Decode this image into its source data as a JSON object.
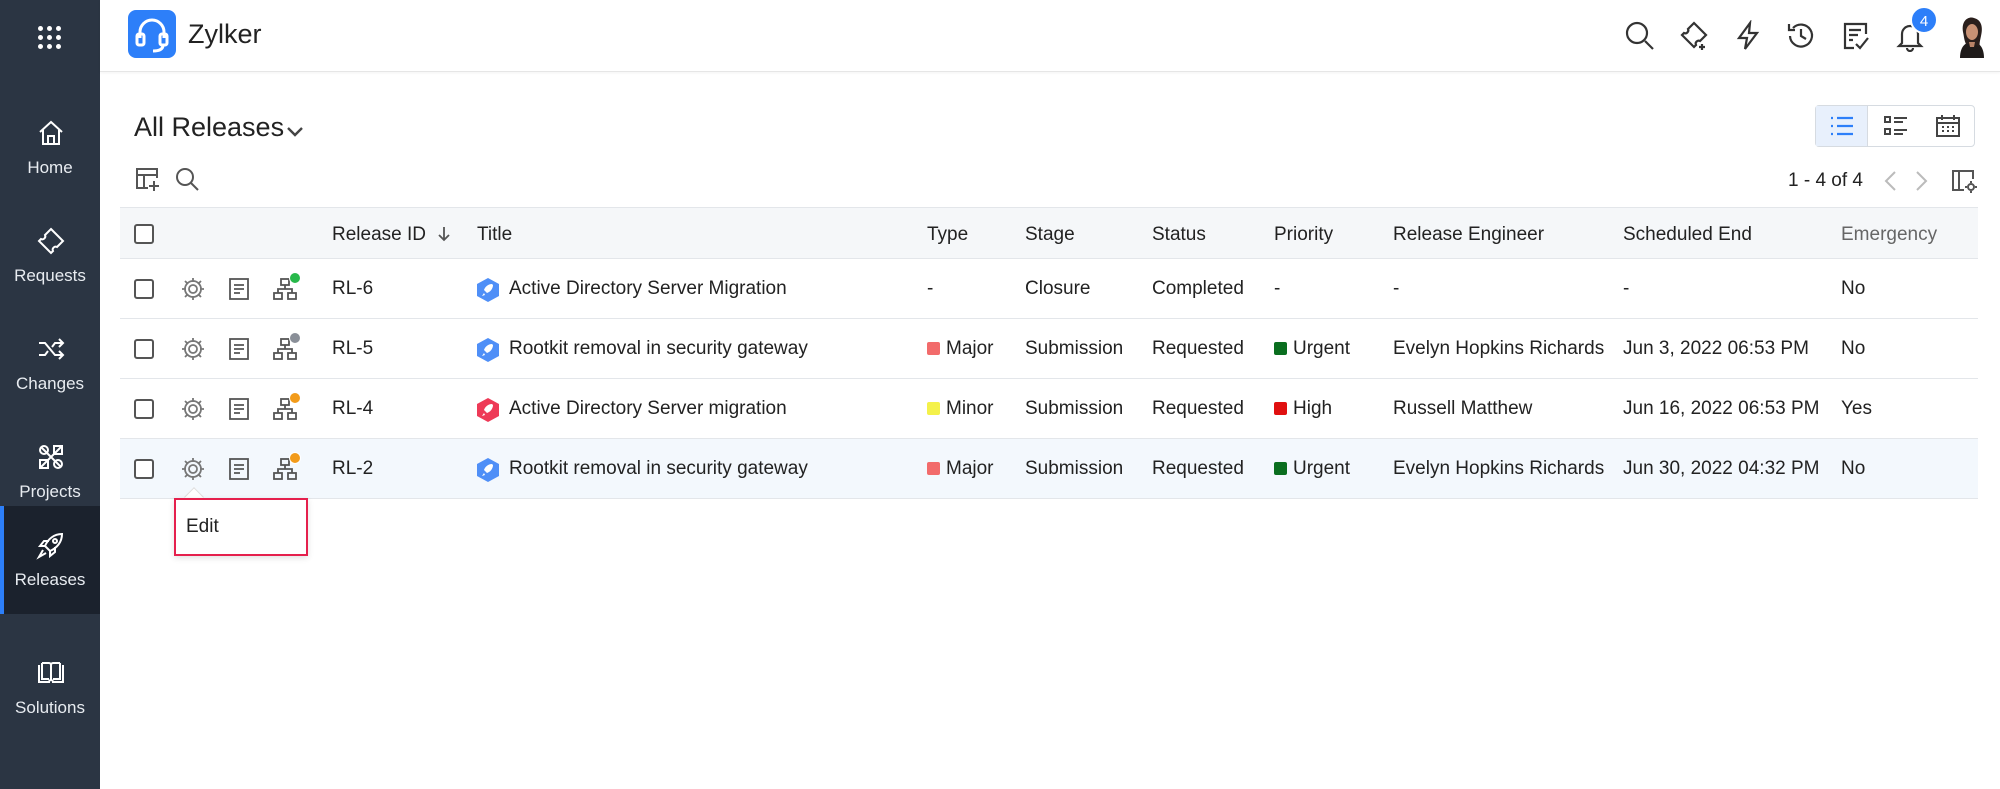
{
  "sidebar": {
    "items": [
      {
        "label": "Home",
        "icon": "home-icon"
      },
      {
        "label": "Requests",
        "icon": "ticket-icon"
      },
      {
        "label": "Changes",
        "icon": "shuffle-icon"
      },
      {
        "label": "Projects",
        "icon": "projects-icon"
      },
      {
        "label": "Releases",
        "icon": "rocket-icon",
        "active": true
      },
      {
        "label": "Solutions",
        "icon": "book-icon"
      }
    ]
  },
  "header": {
    "brand": "Zylker",
    "notification_count": "4",
    "icons": [
      "search-icon",
      "sparkle-ticket-icon",
      "lightning-icon",
      "history-icon",
      "checklist-icon",
      "bell-icon"
    ]
  },
  "page": {
    "title": "All Releases",
    "pagination": "1 - 4 of 4"
  },
  "table": {
    "columns": [
      "Release ID",
      "Title",
      "Type",
      "Stage",
      "Status",
      "Priority",
      "Release Engineer",
      "Scheduled End",
      "Emergency"
    ],
    "rows": [
      {
        "id": "RL-6",
        "title": "Active Directory Server Migration",
        "type": "-",
        "type_color": "",
        "stage": "Closure",
        "status": "Completed",
        "priority": "-",
        "priority_color": "",
        "engineer": "-",
        "scheduled_end": "-",
        "emergency": "No",
        "title_icon_color": "#4f8ff7",
        "status_dot": "#27b84a"
      },
      {
        "id": "RL-5",
        "title": "Rootkit removal in security gateway",
        "type": "Major",
        "type_color": "#f26b6b",
        "stage": "Submission",
        "status": "Requested",
        "priority": "Urgent",
        "priority_color": "#0a6e1f",
        "engineer": "Evelyn Hopkins Richards",
        "scheduled_end": "Jun 3, 2022 06:53 PM",
        "emergency": "No",
        "title_icon_color": "#4f8ff7",
        "status_dot": "#8a8f98"
      },
      {
        "id": "RL-4",
        "title": "Active Directory Server migration",
        "type": "Minor",
        "type_color": "#f4f14a",
        "stage": "Submission",
        "status": "Requested",
        "priority": "High",
        "priority_color": "#e01010",
        "engineer": "Russell Matthew",
        "scheduled_end": "Jun 16, 2022 06:53 PM",
        "emergency": "Yes",
        "title_icon_color": "#ee3a57",
        "status_dot": "#f29b1a"
      },
      {
        "id": "RL-2",
        "title": "Rootkit removal in security gateway",
        "type": "Major",
        "type_color": "#f26b6b",
        "stage": "Submission",
        "status": "Requested",
        "priority": "Urgent",
        "priority_color": "#0a6e1f",
        "engineer": "Evelyn Hopkins Richards",
        "scheduled_end": "Jun 30, 2022 04:32 PM",
        "emergency": "No",
        "title_icon_color": "#4f8ff7",
        "status_dot": "#f29b1a"
      }
    ]
  },
  "popup": {
    "label": "Edit"
  },
  "colors": {
    "sidebar": "#2b3543",
    "accent": "#2d7ff9",
    "popup_border": "#e5204d"
  }
}
